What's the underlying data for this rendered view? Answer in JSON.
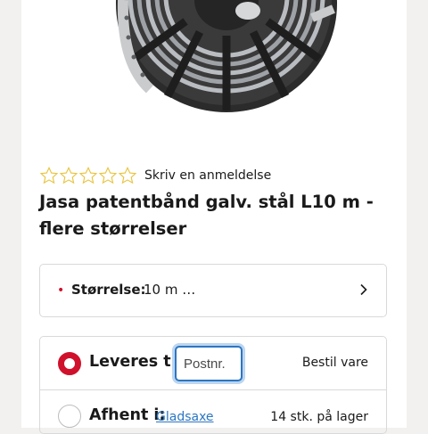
{
  "product": {
    "review_link": "Skriv en anmeldelse",
    "rating_stars": 0,
    "rating_max": 5,
    "title": "Jasa patentbånd galv. stål L10 m - flere størrelser"
  },
  "variant": {
    "label": "Størrelse:",
    "value": "10 m …"
  },
  "delivery": {
    "deliver_label": "Leveres til:",
    "postcode_placeholder": "Postnr.",
    "deliver_action": "Bestil vare",
    "pickup_label": "Afhent i:",
    "pickup_store": "Gladsaxe",
    "pickup_stock": "14 stk. på lager"
  },
  "colors": {
    "accent_red": "#d0112b",
    "link_blue": "#2c76c2",
    "star_outline": "#e8c33b"
  }
}
